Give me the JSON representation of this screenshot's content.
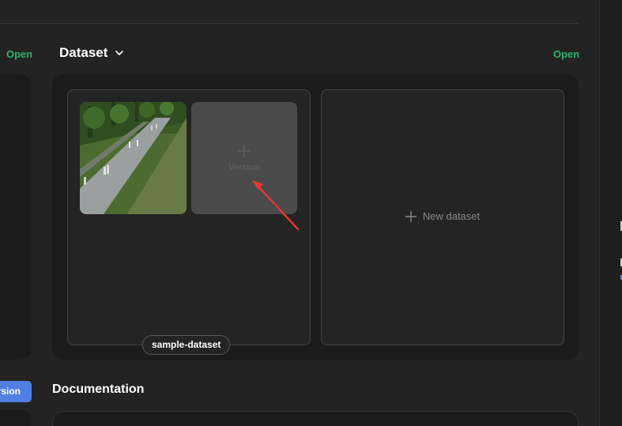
{
  "left_column": {
    "open_label": "Open",
    "version_button_label": "rsion"
  },
  "dataset_section": {
    "title": "Dataset",
    "open_label": "Open"
  },
  "dataset_card": {
    "name": "sample-dataset",
    "version_tile_label": "Version"
  },
  "new_dataset": {
    "label": "New dataset"
  },
  "documentation": {
    "title": "Documentation"
  },
  "colors": {
    "accent_green": "#2fb36a",
    "accent_blue": "#4f7fe0",
    "annotation_red": "#e53935"
  },
  "icons": {
    "chevron": "chevron-down-icon",
    "plus": "plus-icon",
    "arrow": "annotation-arrow-icon"
  }
}
